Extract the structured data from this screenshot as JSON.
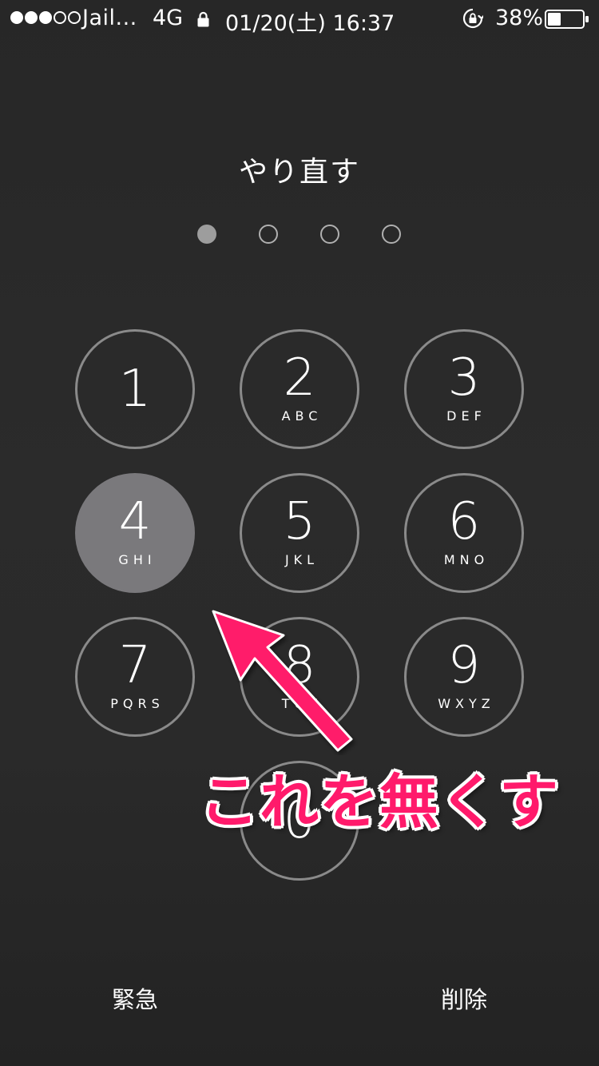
{
  "status_bar": {
    "carrier": "Jail...",
    "network": "4G",
    "datetime": "01/20(土) 16:37",
    "battery_percent": "38%",
    "battery_level": 0.38,
    "signal_bars_filled": 3,
    "signal_bars_total": 5
  },
  "title": "やり直す",
  "passcode": {
    "length": 4,
    "entered": 1
  },
  "keypad": [
    {
      "digit": "1",
      "letters": ""
    },
    {
      "digit": "2",
      "letters": "ABC"
    },
    {
      "digit": "3",
      "letters": "DEF"
    },
    {
      "digit": "4",
      "letters": "GHI",
      "pressed": true
    },
    {
      "digit": "5",
      "letters": "JKL"
    },
    {
      "digit": "6",
      "letters": "MNO"
    },
    {
      "digit": "7",
      "letters": "PQRS"
    },
    {
      "digit": "8",
      "letters": "TUV"
    },
    {
      "digit": "9",
      "letters": "WXYZ"
    },
    {
      "digit": "0",
      "letters": ""
    }
  ],
  "bottom": {
    "emergency": "緊急",
    "delete": "削除"
  },
  "annotation": {
    "text": "これを無くす",
    "color": "#ff1a6b"
  },
  "colors": {
    "background": "#272727",
    "key_border": "#8a8a8a",
    "key_pressed": "#7a797c",
    "pin_filled": "#9d9d9d"
  }
}
